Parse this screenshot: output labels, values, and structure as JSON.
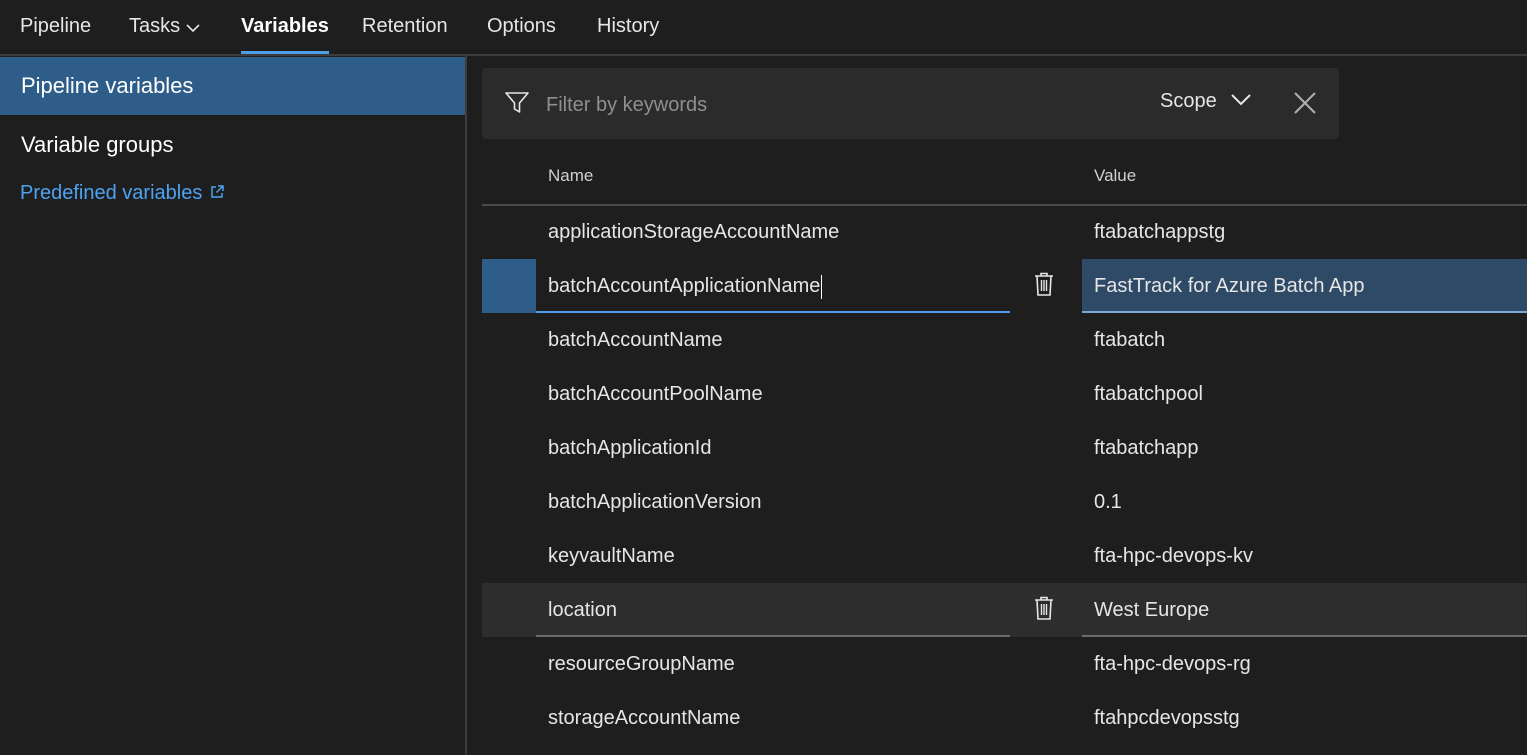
{
  "tabs": [
    {
      "label": "Pipeline"
    },
    {
      "label": "Tasks"
    },
    {
      "label": "Variables"
    },
    {
      "label": "Retention"
    },
    {
      "label": "Options"
    },
    {
      "label": "History"
    }
  ],
  "sidebar": {
    "items": [
      {
        "label": "Pipeline variables",
        "selected": true
      },
      {
        "label": "Variable groups",
        "selected": false
      }
    ],
    "link": "Predefined variables"
  },
  "filter": {
    "placeholder": "Filter by keywords",
    "scope_label": "Scope"
  },
  "table": {
    "headers": {
      "name": "Name",
      "value": "Value"
    },
    "rows": [
      {
        "name": "applicationStorageAccountName",
        "value": "ftabatchappstg"
      },
      {
        "name": "batchAccountApplicationName",
        "value": "FastTrack for Azure Batch App"
      },
      {
        "name": "batchAccountName",
        "value": "ftabatch"
      },
      {
        "name": "batchAccountPoolName",
        "value": "ftabatchpool"
      },
      {
        "name": "batchApplicationId",
        "value": "ftabatchapp"
      },
      {
        "name": "batchApplicationVersion",
        "value": "0.1"
      },
      {
        "name": "keyvaultName",
        "value": "fta-hpc-devops-kv"
      },
      {
        "name": "location",
        "value": "West Europe"
      },
      {
        "name": "resourceGroupName",
        "value": "fta-hpc-devops-rg"
      },
      {
        "name": "storageAccountName",
        "value": "ftahpcdevopsstg"
      }
    ]
  },
  "colors": {
    "accent": "#4f9fe8",
    "selected_bg": "#2f5d8a",
    "link": "#4da3f2"
  }
}
